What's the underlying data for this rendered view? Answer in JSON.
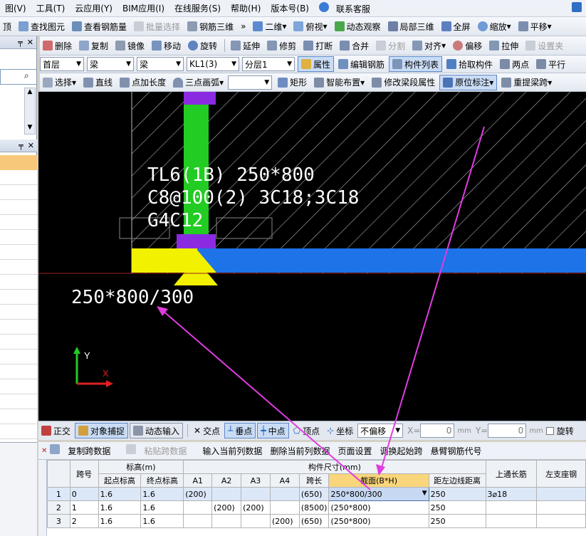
{
  "menu": [
    "图(V)",
    "工具(T)",
    "云应用(Y)",
    "BIM应用(I)",
    "在线服务(S)",
    "帮助(H)",
    "版本号(B)",
    "联系客服"
  ],
  "toolbar1": {
    "items": [
      "顶",
      "查找图元",
      "查看钢筋量",
      "批量选择",
      "钢筋三维",
      "二维",
      "俯视",
      "动态观察",
      "局部三维",
      "全屏",
      "缩放",
      "平移"
    ],
    "overflow": "»"
  },
  "toolbar2": [
    "删除",
    "复制",
    "镜像",
    "移动",
    "旋转",
    "延伸",
    "修剪",
    "打断",
    "合并",
    "分割",
    "对齐",
    "偏移",
    "拉伸",
    "设置夹"
  ],
  "toolbar3": {
    "combos": [
      "首层",
      "梁",
      "梁",
      "KL1(3)",
      "分层1"
    ],
    "buttons": [
      "属性",
      "编辑钢筋",
      "构件列表",
      "拾取构件",
      "两点",
      "平行"
    ]
  },
  "toolbar4": [
    "选择",
    "直线",
    "点加长度",
    "三点画弧",
    "矩形",
    "智能布置",
    "修改梁段属性",
    "原位标注",
    "重提梁跨"
  ],
  "canvas": {
    "annotation_lines": [
      "TL6(1B) 250*800",
      "C8@100(2) 3C18;3C18",
      "G4C12"
    ],
    "section_label": "250*800/300",
    "axis_y": "Y",
    "axis_x": "X"
  },
  "snapbar": {
    "items": [
      "正交",
      "对象捕捉",
      "动态输入",
      "交点",
      "垂点",
      "中点",
      "顶点",
      "坐标"
    ],
    "offset_mode": "不偏移",
    "x_label": "X=",
    "x_value": "0",
    "x_unit": "mm",
    "y_label": "Y=",
    "y_value": "0",
    "y_unit": "mm",
    "rotate_label": "旋转"
  },
  "gridbar": [
    "复制跨数据",
    "粘贴跨数据",
    "输入当前列数据",
    "删除当前列数据",
    "页面设置",
    "调换起始跨",
    "悬臂钢筋代号"
  ],
  "table": {
    "group_headers": {
      "elev": "标高(m)",
      "size": "构件尺寸(mm)"
    },
    "headers": [
      "跨号",
      "起点标高",
      "终点标高",
      "A1",
      "A2",
      "A3",
      "A4",
      "跨长",
      "截面(B*H)",
      "距左边线距离",
      "上通长筋",
      "左支座钢"
    ],
    "rows": [
      {
        "n": "1",
        "span": "0",
        "start": "1.6",
        "end": "1.6",
        "a1": "(200)",
        "a2": "",
        "a3": "",
        "a4": "",
        "len": "(650)",
        "section": "250*800/300",
        "dist": "250",
        "top": "3⌀18",
        "left": ""
      },
      {
        "n": "2",
        "span": "1",
        "start": "1.6",
        "end": "1.6",
        "a1": "",
        "a2": "(200)",
        "a3": "(200)",
        "a4": "",
        "len": "(8500)",
        "section": "(250*800)",
        "dist": "250",
        "top": "",
        "left": ""
      },
      {
        "n": "3",
        "span": "2",
        "start": "1.6",
        "end": "1.6",
        "a1": "",
        "a2": "",
        "a3": "",
        "a4": "(200)",
        "len": "(650)",
        "section": "(250*800)",
        "dist": "250",
        "top": "",
        "left": ""
      }
    ]
  },
  "colors": {
    "accent": "#5d88c6",
    "beam_blue": "#1e73e8",
    "column_green": "#22cc22",
    "support_yellow": "#f2f200",
    "cap_purple": "#8a2be2",
    "arrow_magenta": "#e03ce0"
  }
}
